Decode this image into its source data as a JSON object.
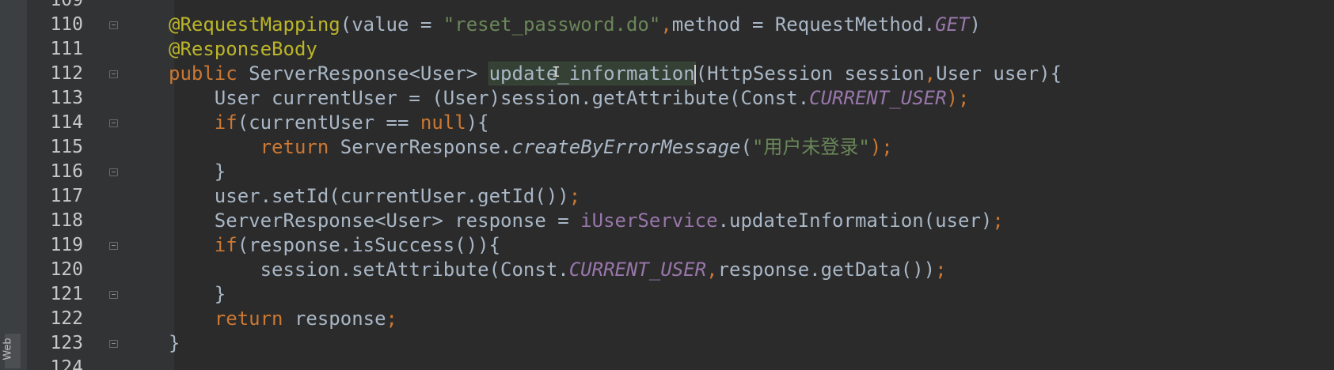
{
  "editor": {
    "side_tab_label": "Web",
    "icons": {
      "fold": "fold-marker-icon",
      "cursor": "text-cursor-icon"
    },
    "colors": {
      "background": "#2b2b2b",
      "annotation": "#bbb529",
      "keyword": "#cc7832",
      "string": "#6a8759",
      "constant": "#9876aa",
      "plain": "#a9b7c6",
      "line_number": "#c8c8c8"
    },
    "lines": [
      {
        "number": "109",
        "fold": false
      },
      {
        "number": "110",
        "fold": true,
        "tokens": [
          {
            "t": "@RequestMapping",
            "c": "ann"
          },
          {
            "t": "(value = ",
            "c": "plain"
          },
          {
            "t": "\"reset_password.do\"",
            "c": "str"
          },
          {
            "t": ",",
            "c": "kw"
          },
          {
            "t": "method = RequestMethod.",
            "c": "plain"
          },
          {
            "t": "GET",
            "c": "const"
          },
          {
            "t": ")",
            "c": "plain"
          }
        ]
      },
      {
        "number": "111",
        "fold": false,
        "tokens": [
          {
            "t": "@ResponseBody",
            "c": "ann"
          }
        ]
      },
      {
        "number": "112",
        "fold": true,
        "tokens": [
          {
            "t": "public ",
            "c": "kw"
          },
          {
            "t": "ServerResponse<User> ",
            "c": "plain"
          },
          {
            "t": "update_information",
            "c": "hl"
          },
          {
            "t": "(HttpSession session",
            "c": "plain"
          },
          {
            "t": ",",
            "c": "kw"
          },
          {
            "t": "User user){",
            "c": "plain"
          }
        ]
      },
      {
        "number": "113",
        "fold": false,
        "tokens": [
          {
            "t": "    User currentUser = (User)session.getAttribute(Const.",
            "c": "plain"
          },
          {
            "t": "CURRENT_USER",
            "c": "const"
          },
          {
            "t": ");",
            "c": "kw"
          }
        ]
      },
      {
        "number": "114",
        "fold": true,
        "tokens": [
          {
            "t": "    ",
            "c": "plain"
          },
          {
            "t": "if",
            "c": "kw"
          },
          {
            "t": "(currentUser == ",
            "c": "plain"
          },
          {
            "t": "null",
            "c": "kw"
          },
          {
            "t": "){",
            "c": "plain"
          }
        ]
      },
      {
        "number": "115",
        "fold": false,
        "tokens": [
          {
            "t": "        ",
            "c": "plain"
          },
          {
            "t": "return ",
            "c": "kw"
          },
          {
            "t": "ServerResponse.",
            "c": "plain"
          },
          {
            "t": "createByErrorMessage",
            "c": "static"
          },
          {
            "t": "(",
            "c": "plain"
          },
          {
            "t": "\"用户未登录\"",
            "c": "str"
          },
          {
            "t": ");",
            "c": "kw"
          }
        ]
      },
      {
        "number": "116",
        "fold": true,
        "tokens": [
          {
            "t": "    }",
            "c": "plain"
          }
        ]
      },
      {
        "number": "117",
        "fold": false,
        "tokens": [
          {
            "t": "    user.setId(currentUser.getId())",
            "c": "plain"
          },
          {
            "t": ";",
            "c": "kw"
          }
        ]
      },
      {
        "number": "118",
        "fold": false,
        "tokens": [
          {
            "t": "    ServerResponse<User> response = ",
            "c": "plain"
          },
          {
            "t": "iUserService",
            "c": "field"
          },
          {
            "t": ".updateInformation(user)",
            "c": "plain"
          },
          {
            "t": ";",
            "c": "kw"
          }
        ]
      },
      {
        "number": "119",
        "fold": true,
        "tokens": [
          {
            "t": "    ",
            "c": "plain"
          },
          {
            "t": "if",
            "c": "kw"
          },
          {
            "t": "(response.isSuccess()){",
            "c": "plain"
          }
        ]
      },
      {
        "number": "120",
        "fold": false,
        "tokens": [
          {
            "t": "        session.setAttribute(Const.",
            "c": "plain"
          },
          {
            "t": "CURRENT_USER",
            "c": "const"
          },
          {
            "t": ",",
            "c": "kw"
          },
          {
            "t": "response.getData())",
            "c": "plain"
          },
          {
            "t": ";",
            "c": "kw"
          }
        ]
      },
      {
        "number": "121",
        "fold": true,
        "tokens": [
          {
            "t": "    }",
            "c": "plain"
          }
        ]
      },
      {
        "number": "122",
        "fold": false,
        "tokens": [
          {
            "t": "    ",
            "c": "plain"
          },
          {
            "t": "return ",
            "c": "kw"
          },
          {
            "t": "response",
            "c": "plain"
          },
          {
            "t": ";",
            "c": "kw"
          }
        ]
      },
      {
        "number": "123",
        "fold": true,
        "tokens": [
          {
            "t": "}",
            "c": "plain"
          }
        ]
      },
      {
        "number": "124",
        "fold": false
      }
    ]
  }
}
